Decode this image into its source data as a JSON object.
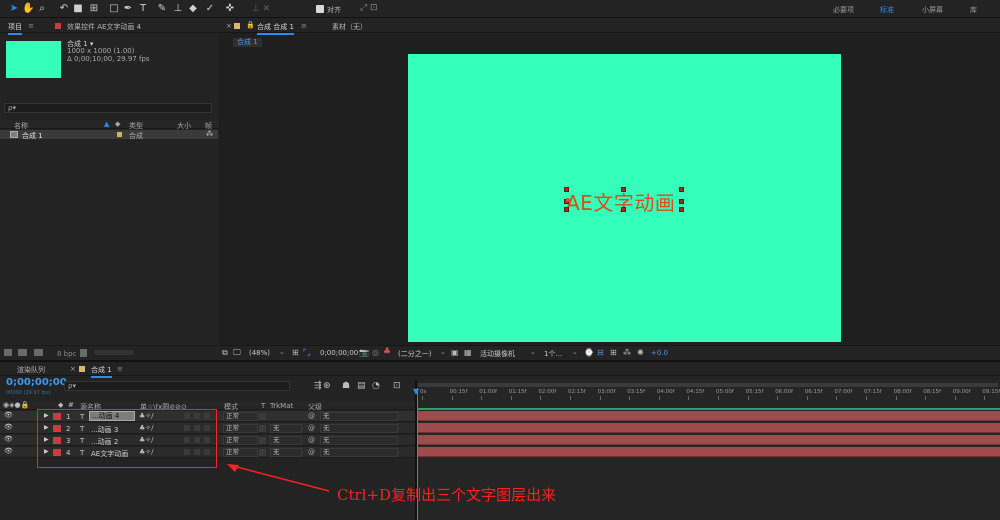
{
  "toolbar": {
    "tools": [
      "selection-tool",
      "hand-tool",
      "zoom-tool",
      "rotate-tool",
      "camera-tool",
      "pan-behind-tool",
      "rectangle-tool",
      "pen-tool",
      "type-tool",
      "brush-tool",
      "clone-stamp-tool",
      "eraser-tool",
      "roto-brush-tool",
      "puppet-tool"
    ],
    "snap_label": "对齐",
    "workspaces": [
      "必要项",
      "标准",
      "小屏幕",
      "库"
    ],
    "active_workspace": "标准"
  },
  "project_panel": {
    "tab_project": "项目",
    "tab_effects": "效果控件 AE文字动画 4",
    "comp_name": "合成 1 ▾",
    "comp_dims": "1000 x 1000 (1.00)",
    "comp_duration": "Δ 0;00;10;00, 29.97 fps",
    "search_placeholder": "ρ▾",
    "columns": [
      "名称",
      "类型",
      "大小",
      "帧"
    ],
    "items": [
      {
        "name": "合成 1",
        "type": "合成"
      }
    ],
    "bpc": "8 bpc",
    "thumb_color": "#33ffbb"
  },
  "viewer": {
    "tab_comp": "合成 合成 1",
    "tab_footage": "素材（无）",
    "breadcrumb": "合成 1",
    "canvas_text": "AE文字动画",
    "canvas_bg": "#33ffbb",
    "text_color": "#e04b14",
    "zoom": "(48%)",
    "timecode": "0;00;00;00",
    "resolution": "(二分之一)",
    "camera": "活动摄像机",
    "views": "1个...",
    "exposure": "+0.0"
  },
  "timeline": {
    "tab_render": "渲染队列",
    "tab_comp": "合成 1",
    "timecode": "0;00;00;00",
    "fps_note": "00000 (29.97 fps)",
    "search_placeholder": "ρ▾",
    "col_name": "源名称",
    "col_switches": "单☆\\fx圆⊘⊘⊙",
    "col_mode": "模式",
    "col_t": "T",
    "col_trkmat": "TrkMat",
    "col_parent": "父级",
    "ruler": [
      "0s",
      "00:15f",
      "01:00f",
      "01:15f",
      "02:00f",
      "02:15f",
      "03:00f",
      "03:15f",
      "04:00f",
      "04:15f",
      "05:00f",
      "05:15f",
      "06:00f",
      "06:15f",
      "07:00f",
      "07:15f",
      "08:00f",
      "08:15f",
      "09:00f",
      "09:15f"
    ],
    "layers": [
      {
        "num": "1",
        "type": "T",
        "name": "...动画 4",
        "mode": "正常",
        "trkmat": "",
        "parent": "无"
      },
      {
        "num": "2",
        "type": "T",
        "name": "...动画 3",
        "mode": "正常",
        "trkmat": "无",
        "parent": "无"
      },
      {
        "num": "3",
        "type": "T",
        "name": "...动画 2",
        "mode": "正常",
        "trkmat": "无",
        "parent": "无"
      },
      {
        "num": "4",
        "type": "T",
        "name": "AE文字动画",
        "mode": "正常",
        "trkmat": "无",
        "parent": "无"
      }
    ],
    "layer_color": "#cc3c3c"
  },
  "annotation": {
    "text": "Ctrl+D复制出三个文字图层出来",
    "color": "#ff2020"
  }
}
